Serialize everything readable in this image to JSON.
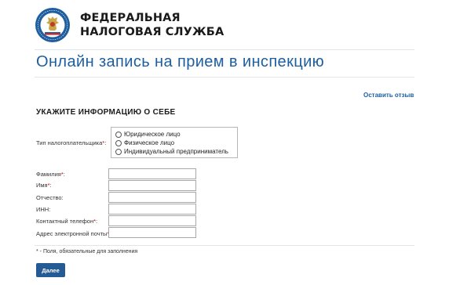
{
  "header": {
    "org_line1": "ФЕДЕРАЛЬНАЯ",
    "org_line2": "НАЛОГОВАЯ СЛУЖБА"
  },
  "page_title": "Онлайн запись на прием в инспекцию",
  "feedback_link": "Оставить отзыв",
  "section_title": "УКАЖИТЕ ИНФОРМАЦИЮ О СЕБЕ",
  "taxpayer_type": {
    "label": "Тип налогоплательщика",
    "options": [
      "Юридическое лицо",
      "Физическое лицо",
      "Индивидуальный предприниматель"
    ]
  },
  "fields": {
    "surname": "Фамилия",
    "name": "Имя",
    "patronymic": "Отчество",
    "inn": "ИНН",
    "phone": "Контактный телефон",
    "email": "Адрес электронной почты"
  },
  "required_mark": "*",
  "required_note": "* - Поля, обязательные для заполнения",
  "next_button": "Далее",
  "colors": {
    "accent": "#1c5ea0",
    "button": "#245b95",
    "required": "#c00000"
  }
}
